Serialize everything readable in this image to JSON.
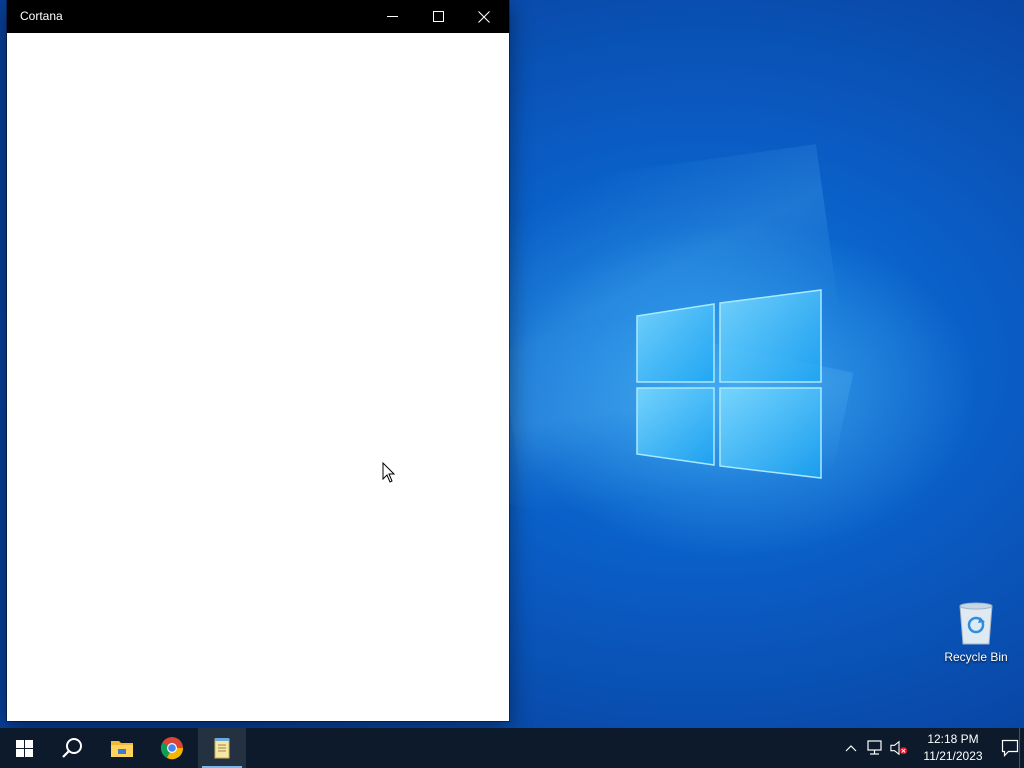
{
  "window": {
    "title": "Cortana"
  },
  "desktop": {
    "icons": [
      {
        "label": "Recycle Bin",
        "icon": "recycle-bin-icon"
      }
    ]
  },
  "taskbar": {
    "items": [
      {
        "name": "start",
        "icon": "windows-logo-icon"
      },
      {
        "name": "search",
        "icon": "search-icon"
      },
      {
        "name": "file-explorer",
        "icon": "folder-icon"
      },
      {
        "name": "chrome",
        "icon": "chrome-icon"
      },
      {
        "name": "notepad",
        "icon": "notepad-icon",
        "active": true
      }
    ],
    "tray": {
      "icons": [
        "chevron-up-icon",
        "network-icon",
        "volume-muted-icon",
        "notification-icon"
      ],
      "time": "12:18 PM",
      "date": "11/21/2023"
    }
  },
  "colors": {
    "titlebar": "#000000",
    "taskbar": "#0c1a2b",
    "desktop_blue": "#0a5cc4",
    "active_indicator": "#76b9ed"
  }
}
